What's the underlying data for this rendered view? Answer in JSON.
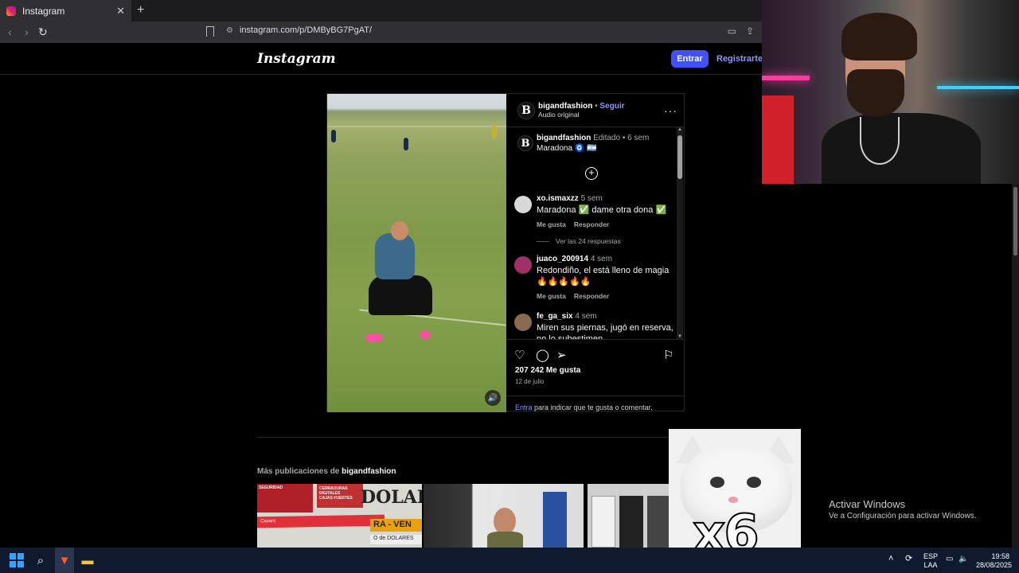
{
  "browser": {
    "tab_title": "Instagram",
    "tab_close": "✕",
    "new_tab": "+",
    "url": "instagram.com/p/DMByBG7PgAT/"
  },
  "ig": {
    "logo": "Instagram",
    "login_button": "Entrar",
    "signup_link": "Registrarte"
  },
  "post": {
    "author": "bigandfashion",
    "follow": "Seguir",
    "separator": "•",
    "audio": "Audio original",
    "caption": {
      "user": "bigandfashion",
      "edited": "Editado",
      "time": "6 sem",
      "text": "Maradona 🧿 🇦🇷"
    },
    "comments": [
      {
        "user": "xo.ismaxzz",
        "time": "5 sem",
        "text": "Maradona ✅ dame otra dona ✅",
        "like": "Me gusta",
        "reply": "Responder",
        "avatar_color": "#d8d8d8"
      },
      {
        "user": "juaco_200914",
        "time": "4 sem",
        "text": "Redondiño, el está lleno de magia 🔥🔥🔥🔥🔥",
        "like": "Me gusta",
        "reply": "Responder",
        "avatar_color": "#a0306a"
      },
      {
        "user": "fe_ga_six",
        "time": "4 sem",
        "text": "Miren sus piernas, jugó en reserva, no lo subestimen.",
        "avatar_color": "#8a6a50"
      }
    ],
    "view_replies": "Ver las 24 respuestas",
    "likes": "207 242 Me gusta",
    "date": "12 de julio",
    "login_link": "Entra",
    "login_prompt": "para indicar que te gusta o comentar."
  },
  "more": {
    "label": "Más publicaciones de",
    "user": "bigandfashion",
    "thumb1_texts": [
      "SEGURIDAD",
      "CERRADURAS DIGITALES",
      "CAJAS FUERTES",
      "DOLAR",
      "Casarq",
      "RA - VEN",
      "O de DOLARES"
    ]
  },
  "meme": {
    "label": "x6"
  },
  "windows": {
    "activate_title": "Activar Windows",
    "activate_sub": "Ve a Configuración para activar Windows.",
    "lang": "ESP",
    "lang_sub": "LAA",
    "time": "19:58",
    "date": "28/08/2025"
  }
}
